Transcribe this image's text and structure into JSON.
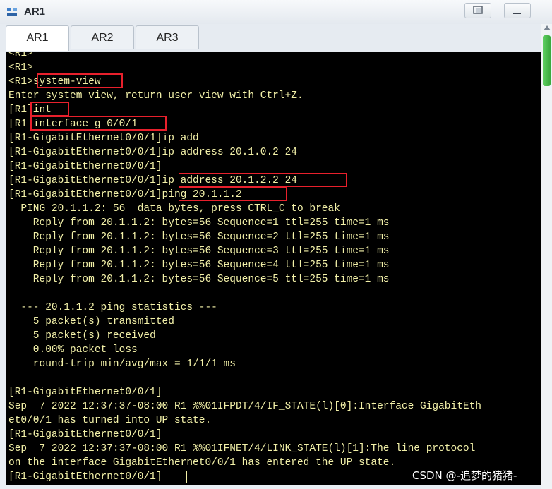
{
  "window": {
    "title": "AR1",
    "icon": "router-icon"
  },
  "tabs": [
    {
      "label": "AR1",
      "active": true
    },
    {
      "label": "AR2",
      "active": false
    },
    {
      "label": "AR3",
      "active": false
    }
  ],
  "terminal": {
    "lines": [
      "<R1>",
      "<R1>",
      "<R1>system-view",
      "Enter system view, return user view with Ctrl+Z.",
      "[R1]int",
      "[R1]interface g 0/0/1",
      "[R1-GigabitEthernet0/0/1]ip add",
      "[R1-GigabitEthernet0/0/1]ip address 20.1.0.2 24",
      "[R1-GigabitEthernet0/0/1]",
      "[R1-GigabitEthernet0/0/1]ip address 20.1.2.2 24",
      "[R1-GigabitEthernet0/0/1]ping 20.1.1.2",
      "  PING 20.1.1.2: 56  data bytes, press CTRL_C to break",
      "    Reply from 20.1.1.2: bytes=56 Sequence=1 ttl=255 time=1 ms",
      "    Reply from 20.1.1.2: bytes=56 Sequence=2 ttl=255 time=1 ms",
      "    Reply from 20.1.1.2: bytes=56 Sequence=3 ttl=255 time=1 ms",
      "    Reply from 20.1.1.2: bytes=56 Sequence=4 ttl=255 time=1 ms",
      "    Reply from 20.1.1.2: bytes=56 Sequence=5 ttl=255 time=1 ms",
      "",
      "  --- 20.1.1.2 ping statistics ---",
      "    5 packet(s) transmitted",
      "    5 packet(s) received",
      "    0.00% packet loss",
      "    round-trip min/avg/max = 1/1/1 ms",
      "",
      "[R1-GigabitEthernet0/0/1]",
      "Sep  7 2022 12:37:37-08:00 R1 %%01IFPDT/4/IF_STATE(l)[0]:Interface GigabitEth",
      "et0/0/1 has turned into UP state.",
      "[R1-GigabitEthernet0/0/1]",
      "Sep  7 2022 12:37:37-08:00 R1 %%01IFNET/4/LINK_STATE(l)[1]:The line protocol",
      "on the interface GigabitEthernet0/0/1 has entered the UP state.",
      "[R1-GigabitEthernet0/0/1]"
    ],
    "highlight_color": "#e8202c",
    "text_color": "#f2f0a8"
  },
  "watermark": "CSDN @-追梦的猪猪-"
}
